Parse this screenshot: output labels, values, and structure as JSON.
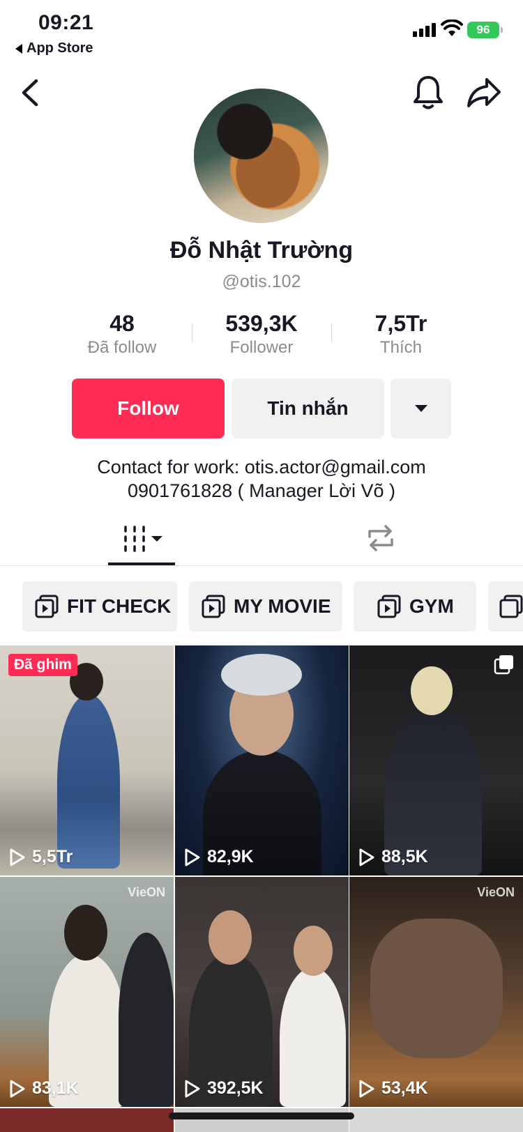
{
  "status_bar": {
    "time": "09:21",
    "back_app": "App Store",
    "battery": "96"
  },
  "profile": {
    "name": "Đỗ Nhật Trường",
    "handle": "@otis.102",
    "stats": [
      {
        "value": "48",
        "label": "Đã follow"
      },
      {
        "value": "539,3K",
        "label": "Follower"
      },
      {
        "value": "7,5Tr",
        "label": "Thích"
      }
    ],
    "buttons": {
      "follow": "Follow",
      "message": "Tin nhắn"
    },
    "bio": [
      "Contact for work: otis.actor@gmail.com",
      "0901761828 ( Manager Lời Võ )"
    ]
  },
  "playlists": [
    "FIT CHECK",
    "MY MOVIE",
    "GYM"
  ],
  "videos": [
    {
      "views": "5,5Tr",
      "badge": "Đã ghim"
    },
    {
      "views": "82,9K"
    },
    {
      "views": "88,5K"
    },
    {
      "views": "83,1K"
    },
    {
      "views": "392,5K"
    },
    {
      "views": "53,4K"
    }
  ],
  "watermark": "VieON"
}
